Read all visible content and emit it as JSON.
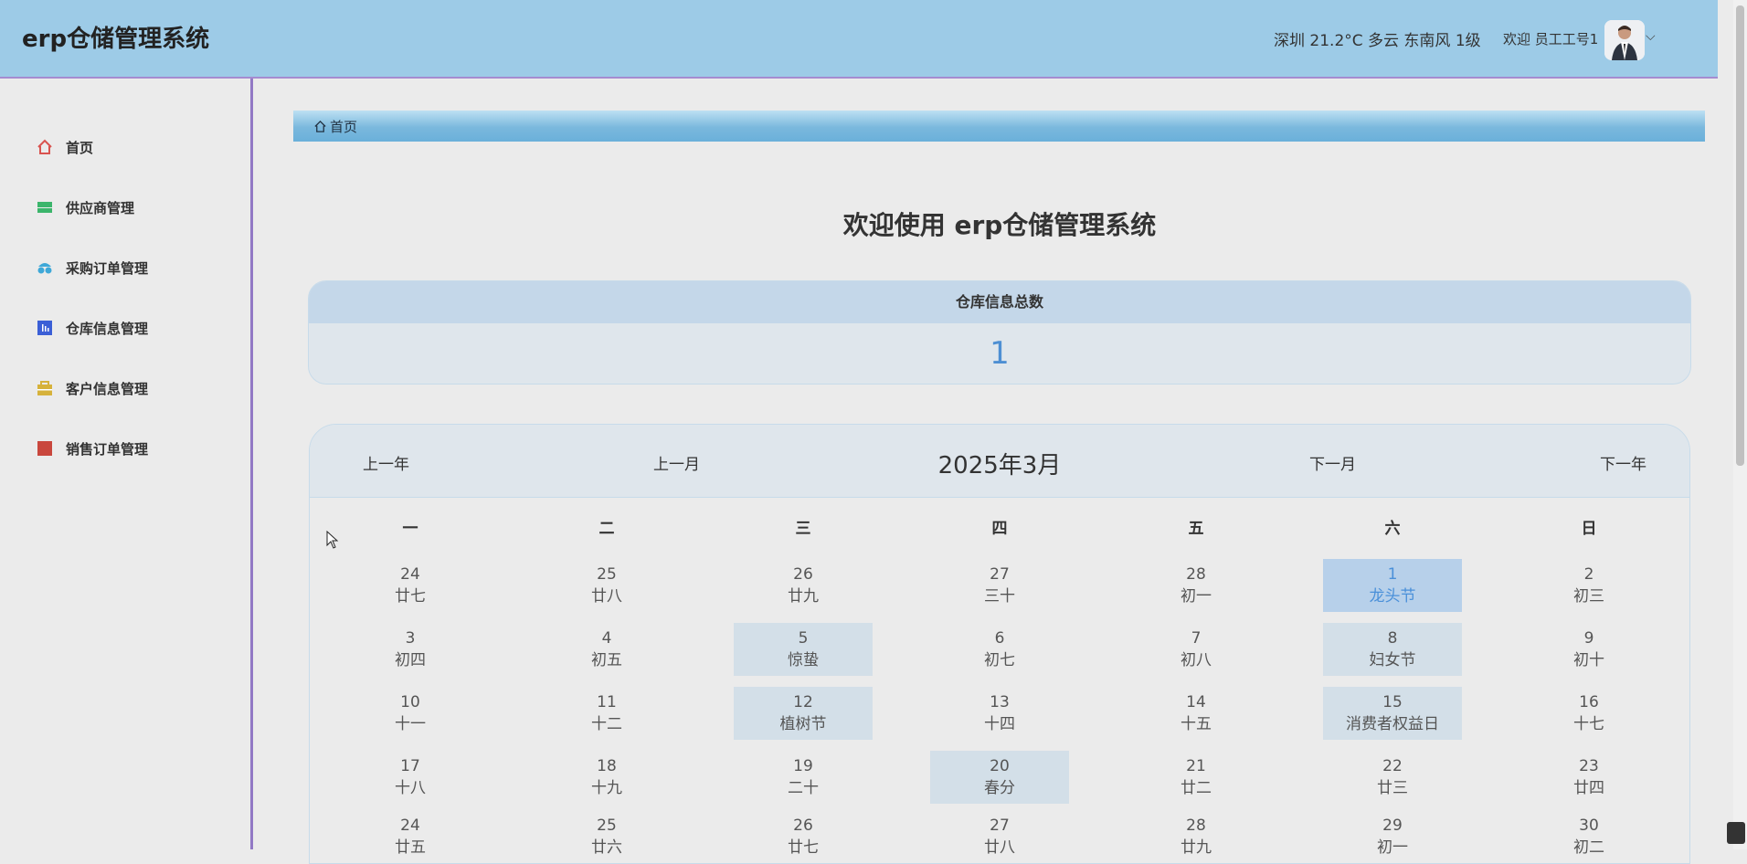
{
  "header": {
    "app_title": "erp仓储管理系统",
    "weather": "深圳 21.2°C 多云 东南风 1级",
    "welcome": "欢迎 员工工号1",
    "caret": "⌵"
  },
  "sidebar": {
    "items": [
      {
        "label": "首页",
        "icon": "home-icon",
        "color": "#d9534f"
      },
      {
        "label": "供应商管理",
        "icon": "supplier-icon",
        "color": "#3bb56b"
      },
      {
        "label": "采购订单管理",
        "icon": "purchase-icon",
        "color": "#3ea8d8"
      },
      {
        "label": "仓库信息管理",
        "icon": "warehouse-icon",
        "color": "#3b5fd6"
      },
      {
        "label": "客户信息管理",
        "icon": "customer-icon",
        "color": "#d6b23b"
      },
      {
        "label": "销售订单管理",
        "icon": "sales-icon",
        "color": "#c9473d"
      }
    ]
  },
  "breadcrumb": {
    "home": "首页"
  },
  "main": {
    "welcome_title": "欢迎使用 erp仓储管理系统",
    "stat": {
      "label": "仓库信息总数",
      "value": "1"
    }
  },
  "calendar": {
    "prev_year": "上一年",
    "prev_month": "上一月",
    "title": "2025年3月",
    "next_month": "下一月",
    "next_year": "下一年",
    "weekdays": [
      "一",
      "二",
      "三",
      "四",
      "五",
      "六",
      "日"
    ],
    "rows": [
      [
        [
          "24",
          "廿七"
        ],
        [
          "25",
          "廿八"
        ],
        [
          "26",
          "廿九"
        ],
        [
          "27",
          "三十"
        ],
        [
          "28",
          "初一"
        ],
        [
          "1",
          "龙头节"
        ],
        [
          "2",
          "初三"
        ]
      ],
      [
        [
          "3",
          "初四"
        ],
        [
          "4",
          "初五"
        ],
        [
          "5",
          "惊蛰"
        ],
        [
          "6",
          "初七"
        ],
        [
          "7",
          "初八"
        ],
        [
          "8",
          "妇女节"
        ],
        [
          "9",
          "初十"
        ]
      ],
      [
        [
          "10",
          "十一"
        ],
        [
          "11",
          "十二"
        ],
        [
          "12",
          "植树节"
        ],
        [
          "13",
          "十四"
        ],
        [
          "14",
          "十五"
        ],
        [
          "15",
          "消费者权益日"
        ],
        [
          "16",
          "十七"
        ]
      ],
      [
        [
          "17",
          "十八"
        ],
        [
          "18",
          "十九"
        ],
        [
          "19",
          "二十"
        ],
        [
          "20",
          "春分"
        ],
        [
          "21",
          "廿二"
        ],
        [
          "22",
          "廿三"
        ],
        [
          "23",
          "廿四"
        ]
      ],
      [
        [
          "24",
          "廿五"
        ],
        [
          "25",
          "廿六"
        ],
        [
          "26",
          "廿七"
        ],
        [
          "27",
          "廿八"
        ],
        [
          "28",
          "廿九"
        ],
        [
          "29",
          "初一"
        ],
        [
          "30",
          "初二"
        ]
      ]
    ],
    "today": "1",
    "highlighted": [
      "5",
      "8",
      "12",
      "15",
      "20"
    ],
    "colors": {
      "highlight": "#d3dfe8",
      "today_bg": "#b7d0ea",
      "today_text": "#4a90d9"
    }
  }
}
